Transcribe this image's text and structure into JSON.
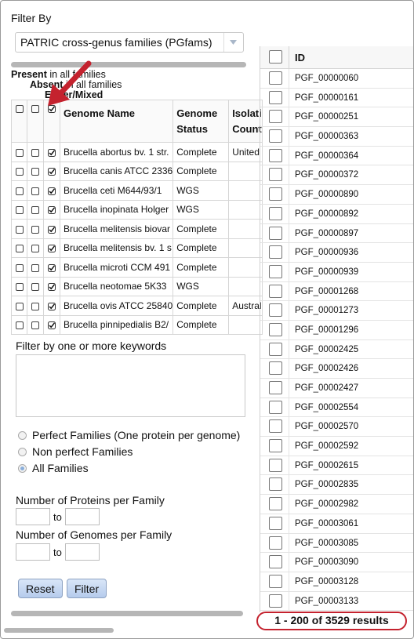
{
  "filter": {
    "title": "Filter By",
    "family_type": "PATRIC cross-genus families (PGfams)"
  },
  "legend": {
    "present_bold": "Present",
    "present_rest": " in all families",
    "absent_bold": "Absent",
    "absent_rest": " in all families",
    "either_bold": "Either/Mixed"
  },
  "genome_table": {
    "headers": [
      "Genome Name",
      "Genome Status",
      "Isolation Country"
    ],
    "header_lines": {
      "name": "Genome Name",
      "status_1": "Genome",
      "status_2": "Status",
      "iso_1": "Isolati",
      "iso_2": "Count"
    },
    "rows": [
      {
        "name": "Brucella abortus bv. 1 str.",
        "status": "Complete",
        "country": "United"
      },
      {
        "name": "Brucella canis ATCC 2336",
        "status": "Complete",
        "country": ""
      },
      {
        "name": "Brucella ceti M644/93/1",
        "status": "WGS",
        "country": ""
      },
      {
        "name": "Brucella inopinata Holger",
        "status": "WGS",
        "country": ""
      },
      {
        "name": "Brucella melitensis biovar",
        "status": "Complete",
        "country": ""
      },
      {
        "name": "Brucella melitensis bv. 1 s",
        "status": "Complete",
        "country": ""
      },
      {
        "name": "Brucella microti CCM 491",
        "status": "Complete",
        "country": ""
      },
      {
        "name": "Brucella neotomae 5K33",
        "status": "WGS",
        "country": ""
      },
      {
        "name": "Brucella ovis ATCC 25840",
        "status": "Complete",
        "country": "Austral"
      },
      {
        "name": "Brucella pinnipedialis B2/",
        "status": "Complete",
        "country": ""
      }
    ]
  },
  "keywords": {
    "label": "Filter by one or more keywords",
    "value": ""
  },
  "family_options": {
    "options": [
      "Perfect Families (One protein per genome)",
      "Non perfect Families",
      "All Families"
    ],
    "selected": "All Families"
  },
  "proteins_per_family": {
    "label": "Number of Proteins per Family",
    "to": "to",
    "min": "",
    "max": ""
  },
  "genomes_per_family": {
    "label": "Number of Genomes per Family",
    "to": "to",
    "min": "",
    "max": ""
  },
  "buttons": {
    "reset": "Reset",
    "filter": "Filter"
  },
  "results_grid": {
    "column": "ID",
    "ids": [
      "PGF_00000060",
      "PGF_00000161",
      "PGF_00000251",
      "PGF_00000363",
      "PGF_00000364",
      "PGF_00000372",
      "PGF_00000890",
      "PGF_00000892",
      "PGF_00000897",
      "PGF_00000936",
      "PGF_00000939",
      "PGF_00001268",
      "PGF_00001273",
      "PGF_00001296",
      "PGF_00002425",
      "PGF_00002426",
      "PGF_00002427",
      "PGF_00002554",
      "PGF_00002570",
      "PGF_00002592",
      "PGF_00002615",
      "PGF_00002835",
      "PGF_00002982",
      "PGF_00003061",
      "PGF_00003085",
      "PGF_00003090",
      "PGF_00003128",
      "PGF_00003133"
    ],
    "summary": "1 - 200 of 3529 results"
  },
  "colors": {
    "annotation_red": "#c4222e",
    "button_blue": "#b5cbec"
  },
  "icons": {
    "dropdown": "chevron-down-icon",
    "annotation": "red-arrow-icon"
  }
}
